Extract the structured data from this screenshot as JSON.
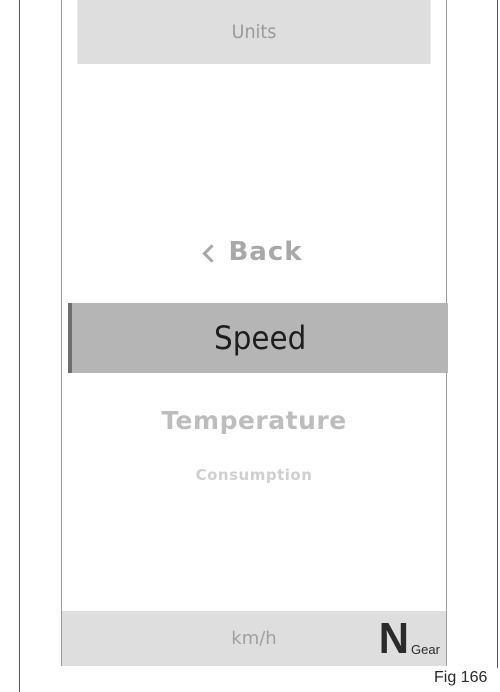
{
  "header": {
    "title": "Units"
  },
  "menu": {
    "back_label": "Back",
    "back_icon": "chevron-left-icon",
    "selected_label": "Speed",
    "items": [
      {
        "label": "Temperature"
      },
      {
        "label": "Consumption"
      }
    ]
  },
  "footer": {
    "unit": "km/h",
    "gear_value": "N",
    "gear_label": "Gear"
  },
  "caption": {
    "figure": "Fig 166"
  },
  "colors": {
    "bar_background": "#dedede",
    "selected_background": "#b5b5b5",
    "selected_accent": "#6e6e6e",
    "text_dark": "#1e1e1e",
    "text_muted": "#a8a8a8"
  }
}
